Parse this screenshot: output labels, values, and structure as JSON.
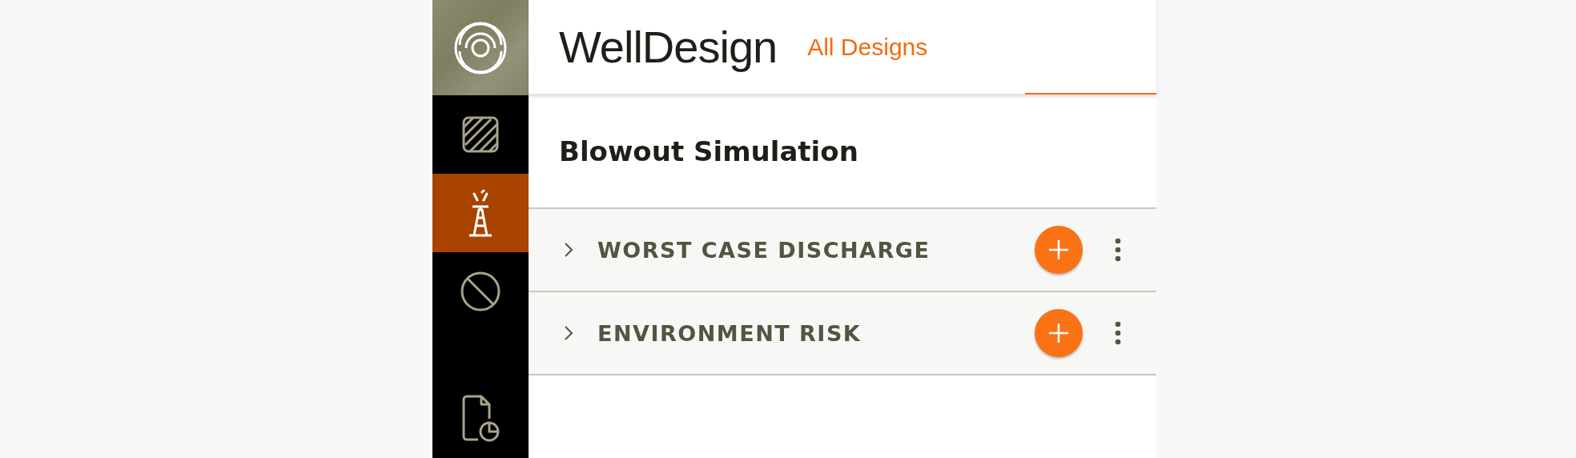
{
  "header": {
    "app_name": "WellDesign",
    "nav_link": "All Designs"
  },
  "sidebar": {
    "items": [
      {
        "kind": "layers",
        "selected": false
      },
      {
        "kind": "derrick",
        "selected": true
      },
      {
        "kind": "blocked",
        "selected": false
      }
    ],
    "bottom_items": [
      {
        "kind": "report",
        "selected": false
      }
    ]
  },
  "page_title": "Blowout Simulation",
  "sections": [
    {
      "title": "WORST CASE DISCHARGE",
      "expanded": false
    },
    {
      "title": "ENVIRONMENT RISK",
      "expanded": false
    }
  ]
}
